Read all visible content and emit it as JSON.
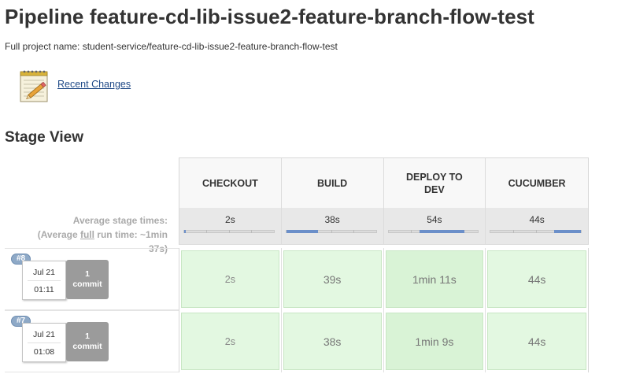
{
  "page": {
    "title": "Pipeline feature-cd-lib-issue2-feature-branch-flow-test",
    "full_project_name": "Full project name: student-service/feature-cd-lib-issue2-feature-branch-flow-test"
  },
  "recent_changes": {
    "icon": "notepad-icon",
    "label": "Recent Changes"
  },
  "stage_view": {
    "title": "Stage View",
    "average_label_line1": "Average stage times:",
    "average_label_line2_prefix": "(Average ",
    "average_label_line2_link": "full",
    "average_label_line2_suffix": " run time: ~1min",
    "average_label_line3": "37s)",
    "stages": [
      {
        "name": "CHECKOUT",
        "avg": "2s",
        "avg_fraction_start": 0.0,
        "avg_fraction_end": 0.02
      },
      {
        "name": "BUILD",
        "avg": "38s",
        "avg_fraction_start": 0.0,
        "avg_fraction_end": 0.35
      },
      {
        "name": "DEPLOY TO DEV",
        "avg": "54s",
        "avg_fraction_start": 0.35,
        "avg_fraction_end": 0.85
      },
      {
        "name": "CUCUMBER",
        "avg": "44s",
        "avg_fraction_start": 0.7,
        "avg_fraction_end": 1.0
      }
    ],
    "builds": [
      {
        "number": "#8",
        "date": "Jul 21",
        "time": "01:11",
        "commits_count": "1",
        "commits_label": "commit",
        "durations": [
          "2s",
          "39s",
          "1min 11s",
          "44s"
        ]
      },
      {
        "number": "#7",
        "date": "Jul 21",
        "time": "01:08",
        "commits_count": "1",
        "commits_label": "commit",
        "durations": [
          "2s",
          "38s",
          "1min 9s",
          "44s"
        ]
      }
    ]
  },
  "colors": {
    "success_cell": "#e3f8e1",
    "link": "#204a87",
    "badge": "#8ea9c7",
    "avg_bar_fill": "#6b8fc9"
  }
}
